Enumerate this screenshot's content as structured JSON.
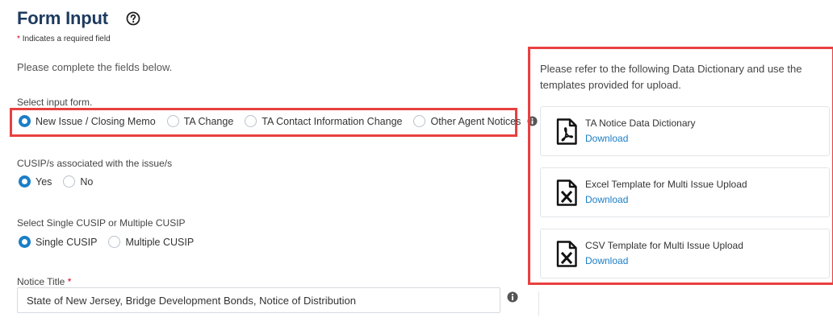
{
  "header": {
    "title": "Form Input",
    "help_icon": "question-circle-icon",
    "required_star": "*",
    "required_note": "Indicates a required field"
  },
  "instructions": "Please complete the fields below.",
  "input_form": {
    "label": "Select input form.",
    "options": [
      {
        "label": "New Issue / Closing Memo",
        "checked": true
      },
      {
        "label": "TA Change",
        "checked": false
      },
      {
        "label": "TA Contact Information Change",
        "checked": false
      },
      {
        "label": "Other Agent Notices",
        "checked": false
      }
    ],
    "info_icon": "info-circle-icon"
  },
  "cusip_assoc": {
    "label": "CUSIP/s associated with the issue/s",
    "options": [
      {
        "label": "Yes",
        "checked": true
      },
      {
        "label": "No",
        "checked": false
      }
    ]
  },
  "cusip_mode": {
    "label": "Select Single CUSIP or Multiple CUSIP",
    "options": [
      {
        "label": "Single CUSIP",
        "checked": true
      },
      {
        "label": "Multiple CUSIP",
        "checked": false
      }
    ]
  },
  "notice_title": {
    "label": "Notice Title",
    "required_star": "*",
    "value": "State of New Jersey, Bridge Development Bonds, Notice of Distribution",
    "info_icon": "info-circle-icon"
  },
  "resources": {
    "intro": "Please refer to the following Data Dictionary and use the templates provided for upload.",
    "documents": [
      {
        "name": "TA Notice Data Dictionary",
        "link": "Download",
        "icon": "pdf-file-icon"
      },
      {
        "name": "Excel Template for Multi Issue Upload",
        "link": "Download",
        "icon": "excel-file-icon"
      },
      {
        "name": "CSV Template for Multi Issue Upload",
        "link": "Download",
        "icon": "csv-file-icon"
      }
    ]
  },
  "colors": {
    "title": "#1d3a5f",
    "accent": "#1a7ec7",
    "highlight": "#e8403f",
    "required": "#d0021b"
  }
}
